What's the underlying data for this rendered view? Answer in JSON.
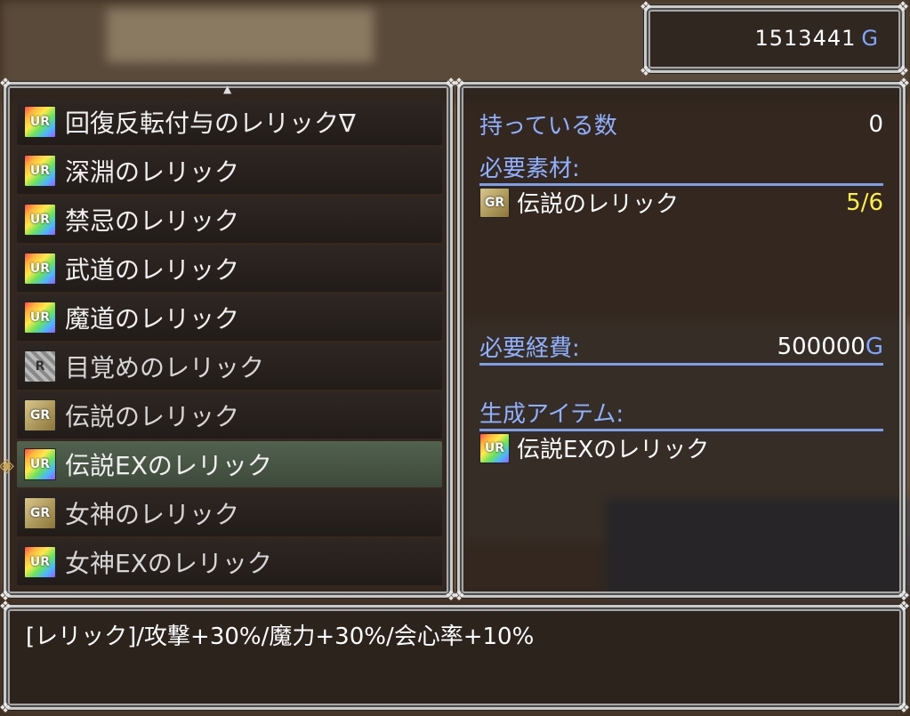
{
  "gold": {
    "amount": "1513441",
    "unit": "G"
  },
  "relic_list": {
    "items": [
      {
        "rank": "UR",
        "name": "回復反転付与のレリック∇",
        "selected": false
      },
      {
        "rank": "UR",
        "name": "深淵のレリック",
        "selected": false
      },
      {
        "rank": "UR",
        "name": "禁忌のレリック",
        "selected": false
      },
      {
        "rank": "UR",
        "name": "武道のレリック",
        "selected": false
      },
      {
        "rank": "UR",
        "name": "魔道のレリック",
        "selected": false
      },
      {
        "rank": "R",
        "name": "目覚めのレリック",
        "selected": false
      },
      {
        "rank": "GR",
        "name": "伝説のレリック",
        "selected": false
      },
      {
        "rank": "UR",
        "name": "伝説EXのレリック",
        "selected": true
      },
      {
        "rank": "GR",
        "name": "女神のレリック",
        "selected": false
      },
      {
        "rank": "UR",
        "name": "女神EXのレリック",
        "selected": false
      }
    ]
  },
  "detail": {
    "owned_label": "持っている数",
    "owned_value": "0",
    "materials_label": "必要素材:",
    "materials": [
      {
        "rank": "GR",
        "name": "伝説のレリック",
        "count": "5/6"
      }
    ],
    "cost_label": "必要経費:",
    "cost_value": "500000",
    "cost_unit": "G",
    "result_label": "生成アイテム:",
    "result": {
      "rank": "UR",
      "name": "伝説EXのレリック"
    }
  },
  "help_text": "[レリック]/攻撃+30%/魔力+30%/会心率+10%",
  "colors": {
    "section_label": "#8fb0ff",
    "count_highlight": "#ffee44",
    "gold_unit": "#7fa7ff",
    "cursor": "#caa652"
  }
}
